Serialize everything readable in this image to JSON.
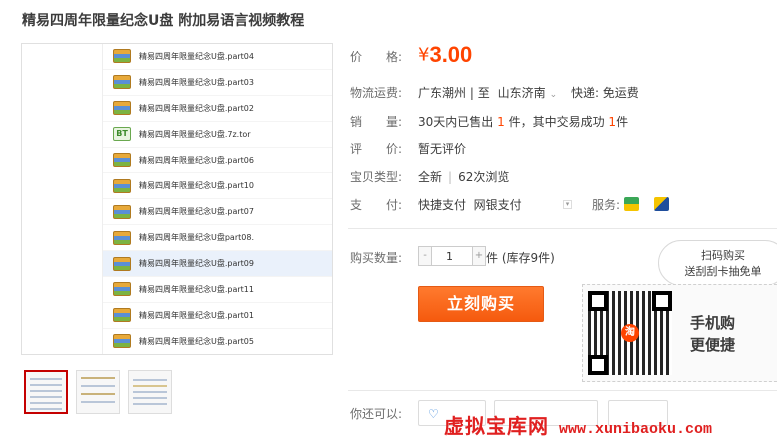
{
  "title": "精易四周年限量纪念U盘 附加易语言视频教程",
  "file_list": [
    {
      "icon": "archive-icon",
      "name": "精易四周年限量纪念U盘.part04"
    },
    {
      "icon": "archive-icon",
      "name": "精易四周年限量纪念U盘.part03"
    },
    {
      "icon": "archive-icon",
      "name": "精易四周年限量纪念U盘.part02"
    },
    {
      "icon": "torrent-icon",
      "name": "精易四周年限量纪念U盘.7z.tor"
    },
    {
      "icon": "archive-icon",
      "name": "精易四周年限量纪念U盘.part06"
    },
    {
      "icon": "archive-icon",
      "name": "精易四周年限量纪念U盘.part10"
    },
    {
      "icon": "archive-icon",
      "name": "精易四周年限量纪念U盘.part07"
    },
    {
      "icon": "archive-icon",
      "name": "精易四周年限量纪念U盘part08."
    },
    {
      "icon": "archive-icon",
      "name": "精易四周年限量纪念U盘.part09"
    },
    {
      "icon": "archive-icon",
      "name": "精易四周年限量纪念U盘.part11"
    },
    {
      "icon": "archive-icon",
      "name": "精易四周年限量纪念U盘.part01"
    },
    {
      "icon": "archive-icon",
      "name": "精易四周年限量纪念U盘.part05"
    }
  ],
  "price": {
    "label": "价　　格:",
    "currency": "¥",
    "value": "3.00"
  },
  "shipping": {
    "label": "物流运费:",
    "from": "广东潮州",
    "sep": "|",
    "to_word": "至",
    "to": "山东济南",
    "fee": "快递: 免运费"
  },
  "sales": {
    "label": "销　　量:",
    "prefix": "30天内已售出",
    "sold": "1",
    "unit1": "件，其中交易成功",
    "success": "1",
    "unit2": "件"
  },
  "review": {
    "label": "评　　价:",
    "value": "暂无评价"
  },
  "item_type": {
    "label": "宝贝类型:",
    "condition": "全新",
    "sep": "|",
    "views": "62次浏览"
  },
  "payment": {
    "label": "支　　付:",
    "methods": "快捷支付  网银支付",
    "service_label": "服务:"
  },
  "quantity": {
    "label": "购买数量:",
    "minus": "-",
    "value": "1",
    "plus": "+",
    "stock": "件 (库存9件)"
  },
  "buy_button": "立刻购买",
  "qr_bubble": {
    "line1": "扫码购买",
    "line2": "送刮刮卡抽免单"
  },
  "qr_center": "淘",
  "mobile": {
    "line1": "手机购",
    "line2": "更便捷"
  },
  "also": {
    "label": "你还可以:"
  },
  "watermark": {
    "text": "虚拟宝库网",
    "url": "www.xunibaoku.com"
  },
  "colors": {
    "accent": "#ff4400",
    "buy_button": "#f55a0e",
    "watermark": "#e02020"
  }
}
